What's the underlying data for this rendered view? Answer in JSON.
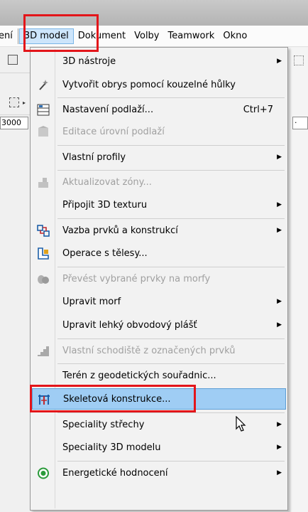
{
  "menubar": {
    "items": [
      {
        "label": "ení",
        "name": "menu-item-previous-partial"
      },
      {
        "label": "3D model",
        "name": "menu-item-3d-model"
      },
      {
        "label": "Dokument",
        "name": "menu-item-dokument"
      },
      {
        "label": "Volby",
        "name": "menu-item-volby"
      },
      {
        "label": "Teamwork",
        "name": "menu-item-teamwork"
      },
      {
        "label": "Okno",
        "name": "menu-item-okno"
      }
    ]
  },
  "toolbar": {
    "coord_value": "3000",
    "right_field_value": "·"
  },
  "dropdown": {
    "items": [
      {
        "label": "3D nástroje",
        "icon": "",
        "submenu": true,
        "disabled": false
      },
      {
        "label": "Vytvořit obrys pomocí kouzelné hůlky",
        "icon": "magic-wand-icon",
        "submenu": false,
        "disabled": false
      },
      {
        "label": "Nastavení podlaží...",
        "icon": "story-settings-icon",
        "shortcut": "Ctrl+7",
        "submenu": false,
        "disabled": false
      },
      {
        "label": "Editace úrovní podlaží",
        "icon": "story-levels-icon",
        "submenu": false,
        "disabled": true
      },
      {
        "label": "Vlastní profily",
        "icon": "",
        "submenu": true,
        "disabled": false
      },
      {
        "label": "Aktualizovat zóny...",
        "icon": "update-zones-icon",
        "submenu": false,
        "disabled": true
      },
      {
        "label": "Připojit 3D texturu",
        "icon": "",
        "submenu": true,
        "disabled": false
      },
      {
        "label": "Vazba prvků a konstrukcí",
        "icon": "element-connection-icon",
        "submenu": true,
        "disabled": false
      },
      {
        "label": "Operace s tělesy...",
        "icon": "solid-operations-icon",
        "submenu": false,
        "disabled": false
      },
      {
        "label": "Převést vybrané prvky na morfy",
        "icon": "convert-morph-icon",
        "submenu": false,
        "disabled": true
      },
      {
        "label": "Upravit morf",
        "icon": "",
        "submenu": true,
        "disabled": false
      },
      {
        "label": "Upravit lehký obvodový plášť",
        "icon": "",
        "submenu": true,
        "disabled": false
      },
      {
        "label": "Vlastní schodiště z označených prvků",
        "icon": "custom-stair-icon",
        "submenu": false,
        "disabled": true
      },
      {
        "label": "Terén z geodetických souřadnic...",
        "icon": "",
        "submenu": false,
        "disabled": false
      },
      {
        "label": "Skeletová konstrukce...",
        "icon": "skeleton-structure-icon",
        "submenu": false,
        "disabled": false,
        "selected": true
      },
      {
        "label": "Speciality střechy",
        "icon": "",
        "submenu": true,
        "disabled": false
      },
      {
        "label": "Speciality 3D modelu",
        "icon": "",
        "submenu": true,
        "disabled": false
      },
      {
        "label": "Energetické hodnocení",
        "icon": "energy-evaluation-icon",
        "submenu": true,
        "disabled": false
      }
    ]
  },
  "colors": {
    "highlight_box": "#e3151a",
    "selected_row": "#9fcdf4",
    "active_menu": "#cde5fb"
  }
}
